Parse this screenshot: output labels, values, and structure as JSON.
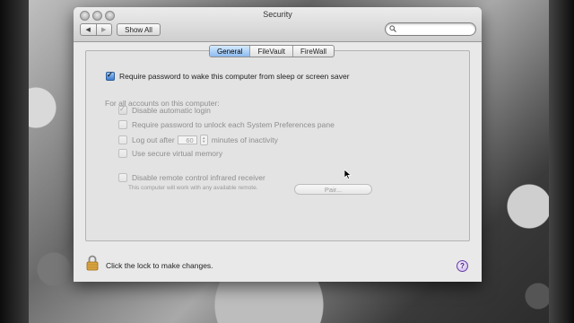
{
  "window": {
    "title": "Security"
  },
  "toolbar": {
    "back_icon": "chevron-left-icon",
    "forward_icon": "chevron-right-icon",
    "show_all_label": "Show All",
    "search": {
      "placeholder": "",
      "value": "",
      "icon": "search-icon"
    }
  },
  "tabs": [
    {
      "label": "General",
      "selected": true
    },
    {
      "label": "FileVault",
      "selected": false
    },
    {
      "label": "FireWall",
      "selected": false
    }
  ],
  "general": {
    "require_password": {
      "label": "Require password to wake this computer from sleep or screen saver",
      "checked": true
    },
    "all_accounts_label": "For all accounts on this computer:",
    "disable_auto_login": {
      "label": "Disable automatic login",
      "checked": true
    },
    "require_password_prefs": {
      "label": "Require password to unlock each System Preferences pane",
      "checked": false
    },
    "logout": {
      "label_before": "Log out after",
      "minutes": "60",
      "label_after": "minutes of inactivity",
      "checked": false
    },
    "secure_vm": {
      "label": "Use secure virtual memory",
      "checked": false
    },
    "disable_ir": {
      "label": "Disable remote control infrared receiver",
      "checked": false
    },
    "ir_note": "This computer will work with any available remote.",
    "pair_label": "Pair..."
  },
  "footer": {
    "lock_icon": "lock-icon",
    "lock_text": "Click the lock to make changes.",
    "help_label": "?"
  },
  "colors": {
    "window_bg": "#e9e9e9",
    "tab_selected": "#8dbbf0",
    "disabled_text": "#8e8e8e",
    "help_purple": "#6b3fa8"
  }
}
